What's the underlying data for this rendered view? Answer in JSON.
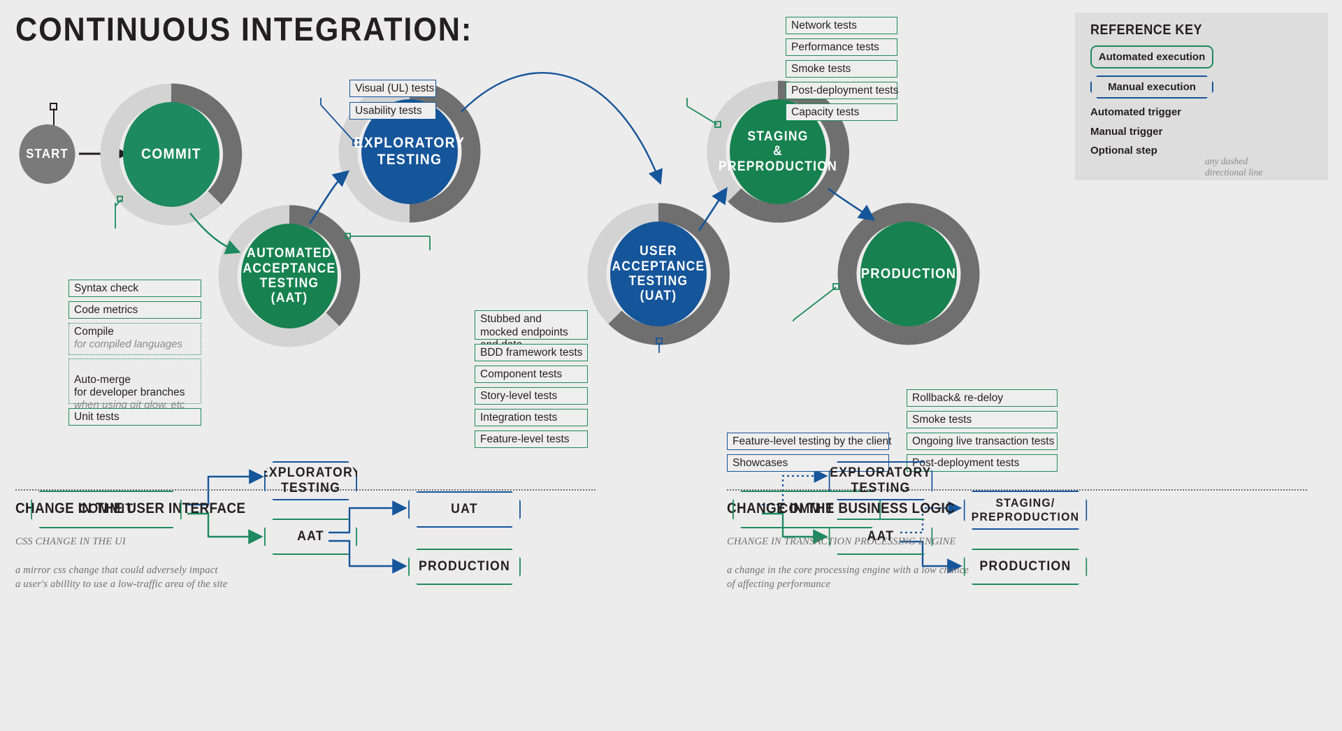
{
  "page": {
    "title": "CONTINUOUS INTEGRATION:",
    "background": "#edecec",
    "colors": {
      "green": "#1d8a5f",
      "blue": "#15559a",
      "dark_gray": "#6f6f6f",
      "light_gray": "#d3d3d3",
      "start_gray": "#7a7a7a"
    }
  },
  "nodes": {
    "start": "START",
    "commit": "COMMIT",
    "exploratory": "EXPLORATORY\nTESTING",
    "aat": "AUTOMATED\nACCEPTANCE\nTESTING\n(AAT)",
    "staging": "STAGING\n&\nPREPRODUCTION",
    "uat": "USER\nACCEPTANCE\nTESTING\n(UAT)",
    "production": "PRODUCTION"
  },
  "commit_labels": [
    {
      "text": "Syntax check",
      "optional": false,
      "sub": ""
    },
    {
      "text": "Code metrics",
      "optional": false,
      "sub": ""
    },
    {
      "text": "Compile",
      "optional": true,
      "sub": "for compiled languages"
    },
    {
      "text": "Auto-merge\nfor developer branches",
      "optional": true,
      "sub": "when using git glow, etc"
    },
    {
      "text": "Unit tests",
      "optional": false,
      "sub": ""
    }
  ],
  "exploratory_labels": [
    {
      "text": "Visual (UL) tests"
    },
    {
      "text": "Usability tests"
    }
  ],
  "aat_labels": [
    {
      "text": "Stubbed and mocked endpoints and data"
    },
    {
      "text": "BDD framework tests"
    },
    {
      "text": "Component tests"
    },
    {
      "text": "Story-level tests"
    },
    {
      "text": "Integration tests"
    },
    {
      "text": "Feature-level tests"
    }
  ],
  "staging_labels": [
    {
      "text": "Network tests"
    },
    {
      "text": "Performance tests"
    },
    {
      "text": "Smoke tests"
    },
    {
      "text": "Post-deployment tests"
    },
    {
      "text": "Capacity tests"
    }
  ],
  "uat_labels": [
    {
      "text": "Feature-level testing by the client"
    },
    {
      "text": "Showcases"
    }
  ],
  "production_labels": [
    {
      "text": "Rollback& re-deloy"
    },
    {
      "text": "Smoke tests"
    },
    {
      "text": "Ongoing live transaction tests"
    },
    {
      "text": "Post-deployment tests"
    }
  ],
  "reference_key": {
    "title": "REFERENCE KEY",
    "automated_execution": "Automated execution",
    "manual_execution": "Manual execution",
    "automated_trigger": "Automated trigger",
    "manual_trigger": "Manual trigger",
    "optional_step": "Optional step",
    "optional_note": "any dashed\ndirectional line"
  },
  "sections": [
    {
      "title": "CHANGE IN THE USER INTERFACE",
      "subtitle": "CSS CHANGE IN THE UI",
      "body": "a mirror css change that could adversely impact\na user's abillity to use a low-traffic area of the site",
      "boxes": {
        "commit": "COMMIT",
        "exploratory": "EXPLORATORY\nTESTING",
        "aat": "AAT",
        "uat": "UAT",
        "production": "PRODUCTION"
      }
    },
    {
      "title": "CHANGE IN THE BUSINESS LOGIC",
      "subtitle": "CHANGE IN TRANSACTION PROCESSING ENGINE",
      "body": "a change in the core processing engine with a low chance\nof affecting performance",
      "boxes": {
        "commit": "COMMIT",
        "exploratory": "EXPLORATORY\nTESTING",
        "aat": "AAT",
        "staging": "STAGING/\nPREPRODUCTION",
        "production": "PRODUCTION"
      }
    }
  ]
}
